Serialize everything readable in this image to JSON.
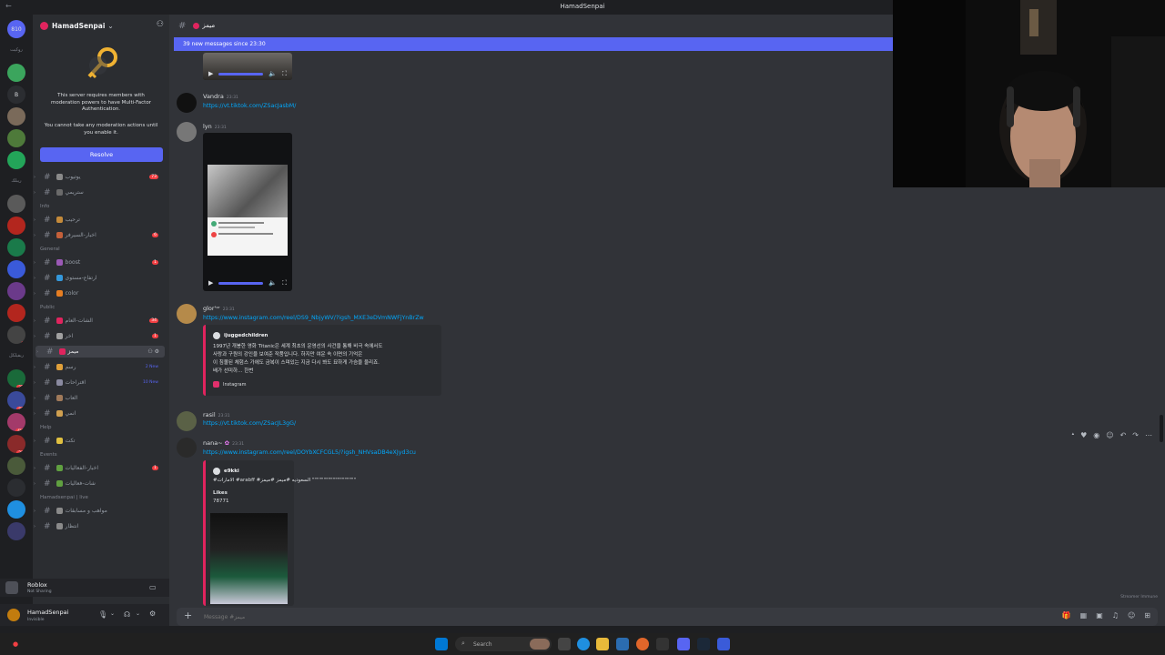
{
  "window": {
    "title": "HamadSenpai"
  },
  "servers": [
    {
      "label": "810"
    },
    {
      "label": "روكيت"
    },
    {
      "label": "",
      "badge": "1"
    },
    {
      "label": "B"
    },
    {
      "label": ""
    },
    {
      "label": ""
    },
    {
      "label": ""
    },
    {
      "label": "ريبلك"
    },
    {
      "label": ""
    },
    {
      "label": ""
    },
    {
      "label": ""
    },
    {
      "label": ""
    },
    {
      "label": ""
    },
    {
      "label": ""
    },
    {
      "label": "",
      "badge": "1"
    },
    {
      "label": "ريفيلكل"
    },
    {
      "label": "",
      "badge": "323"
    },
    {
      "label": "",
      "badge": "869"
    },
    {
      "label": "",
      "badge": "6K+"
    },
    {
      "label": "",
      "badge": "267"
    },
    {
      "label": ""
    },
    {
      "label": ""
    },
    {
      "label": ""
    },
    {
      "label": ""
    }
  ],
  "sidebar": {
    "server_name": "HamadSenpai",
    "mfa_text": "This server requires members with moderation powers to have Multi-Factor Authentication.",
    "mfa_text2": "You cannot take any moderation actions until you enable it.",
    "resolve_label": "Resolve",
    "channels": [
      {
        "name": "يوتيوب",
        "count": "73"
      },
      {
        "name": "ستريمي"
      },
      {
        "category": "Info"
      },
      {
        "name": "ترحيب"
      },
      {
        "name": "اخبار-السيرفر",
        "count": "6"
      },
      {
        "category": "General"
      },
      {
        "name": "boost",
        "count": "1"
      },
      {
        "name": "ارتفاع-مستوى"
      },
      {
        "name": "color"
      },
      {
        "category": "Public"
      },
      {
        "name": "الشات-العام",
        "count": "34"
      },
      {
        "name": "اخر",
        "count": "1"
      },
      {
        "name": "ميمز",
        "active": true
      },
      {
        "name": "رسم",
        "new": "2 New"
      },
      {
        "name": "اقتراحات",
        "new": "10 New"
      },
      {
        "name": "العاب"
      },
      {
        "name": "انمي"
      },
      {
        "category": "Help"
      },
      {
        "name": "تكت"
      },
      {
        "category": "Events"
      },
      {
        "name": "اخبار-الفعاليات",
        "count": "1"
      },
      {
        "name": "شات-فعاليات"
      },
      {
        "category": "Hamadsenpai | live"
      },
      {
        "name": "مواهب و مسابقات"
      },
      {
        "name": "انتظار"
      }
    ]
  },
  "voice": {
    "title": "Roblox",
    "status": "Not Sharing"
  },
  "user": {
    "name": "HamadSenpai",
    "status": "Invisible"
  },
  "chat": {
    "channel_name": "ميمز",
    "new_messages": "39 new messages since 23:30",
    "messages": [
      {
        "author": "Vandra",
        "time": "23:31",
        "link": "https://vt.tiktok.com/ZSacJasbM/"
      },
      {
        "author": "lyn",
        "time": "23:31"
      },
      {
        "author": "glor'ᵒʳ",
        "time": "23:31",
        "link": "https://www.instagram.com/reel/DS9_NbjyWV/?igsh_MXE3eDVmNWFjYnBrZw",
        "embed": {
          "author": "ijuggedchildren",
          "desc": "1997년 개봉한 영화 Titanic은 세계 최초의 운영선의 사건을 통해 비극 속에서도\n사랑과 구원의 강인을 보여준 작품입니다. 하지만 여운 속 이면의 기억은\n이 침몰된 체험스 가에도 금복이 스며있는 지금 다시 봐도 묘하게 가슴을 울리죠.\n배가 선미하… 한번",
          "footer": "Instagram"
        }
      },
      {
        "author": "rasil",
        "time": "23:31",
        "link": "https://vt.tiktok.com/ZSacJL3gG/"
      },
      {
        "author": "nana~",
        "time": "23:31",
        "link": "https://www.instagram.com/reel/DOYbXCFCGL5/?igsh_NHVsaDB4eXJyd3cu",
        "embed": {
          "author": "e9kki",
          "desc": "#الامارات #arabff #السعوديه #ميمز #ميمز ‎\"\"\"\"\"\"\"\"\"\"\"\"\"\"\"\"\"\"\"",
          "likes_label": "Likes",
          "likes": "78771"
        }
      }
    ],
    "composer_placeholder": "Message #ميمز",
    "streamer_mode": "Streamer Immune"
  },
  "taskbar": {
    "search_placeholder": "Search"
  },
  "colors": {
    "accent": "#5865f2",
    "background": "#313338",
    "sidebar": "#2b2d31",
    "link": "#00a8fc"
  }
}
